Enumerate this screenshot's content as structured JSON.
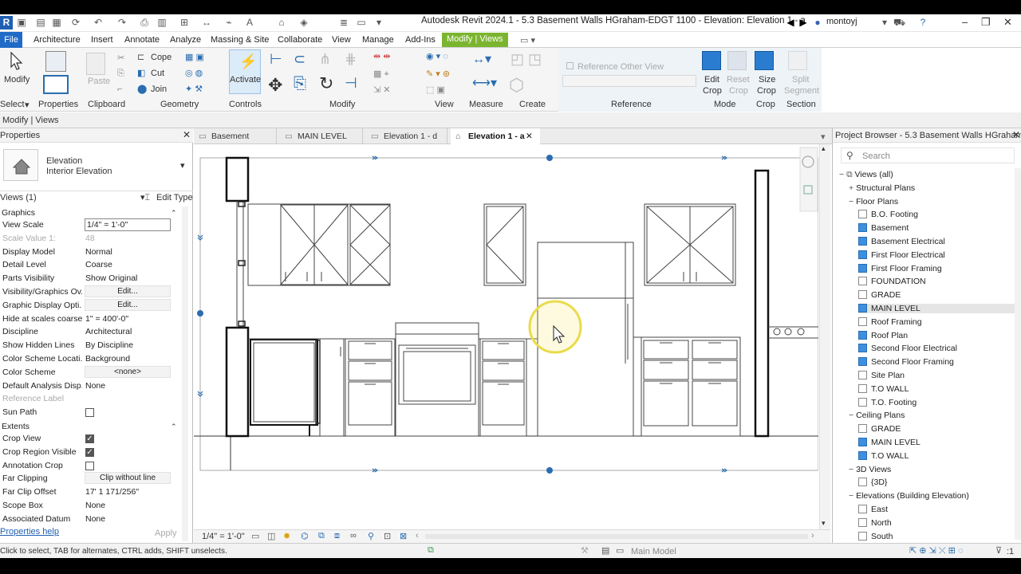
{
  "app": {
    "title": "Autodesk Revit 2024.1 - 5.3 Basement Walls HGraham-EDGT 1100 - Elevation: Elevation 1 - a",
    "logo": "R",
    "user": "montoyj"
  },
  "tabs": [
    "File",
    "Architecture",
    "Insert",
    "Annotate",
    "Analyze",
    "Massing & Site",
    "Collaborate",
    "View",
    "Manage",
    "Add-Ins",
    "Modify | Views"
  ],
  "ribbon": {
    "modify": "Modify",
    "select": "Select",
    "properties": "Properties",
    "clipboard": "Clipboard",
    "paste": "Paste",
    "cope": "Cope",
    "cut": "Cut",
    "join": "Join",
    "geometry": "Geometry",
    "activate": "Activate",
    "controls": "Controls",
    "modify_panel": "Modify",
    "view": "View",
    "measure": "Measure",
    "create": "Create",
    "ref_other_view": "Reference Other View",
    "reference": "Reference",
    "edit_crop_1": "Edit",
    "edit_crop_2": "Crop",
    "reset_crop_1": "Reset",
    "reset_crop_2": "Crop",
    "size_crop_1": "Size",
    "size_crop_2": "Crop",
    "split_seg_1": "Split",
    "split_seg_2": "Segment",
    "mode": "Mode",
    "crop": "Crop",
    "section": "Section"
  },
  "option_bar": "Modify | Views",
  "properties": {
    "header": "Properties",
    "type_1": "Elevation",
    "type_2": "Interior Elevation",
    "selector": "Views (1)",
    "edit_type": "Edit Type",
    "sections": {
      "graphics": "Graphics",
      "extents": "Extents"
    },
    "rows": [
      {
        "k": "View Scale",
        "v": "1/4\" = 1'-0\"",
        "kind": "input"
      },
      {
        "k": "Scale Value    1:",
        "v": "48",
        "kind": "dim"
      },
      {
        "k": "Display Model",
        "v": "Normal",
        "kind": "text"
      },
      {
        "k": "Detail Level",
        "v": "Coarse",
        "kind": "text"
      },
      {
        "k": "Parts Visibility",
        "v": "Show Original",
        "kind": "text"
      },
      {
        "k": "Visibility/Graphics Ov...",
        "v": "Edit...",
        "kind": "btn"
      },
      {
        "k": "Graphic Display Opti...",
        "v": "Edit...",
        "kind": "btn"
      },
      {
        "k": "Hide at scales coarse...",
        "v": "1\" = 400'-0\"",
        "kind": "text"
      },
      {
        "k": "Discipline",
        "v": "Architectural",
        "kind": "text"
      },
      {
        "k": "Show Hidden Lines",
        "v": "By Discipline",
        "kind": "text"
      },
      {
        "k": "Color Scheme Locati...",
        "v": "Background",
        "kind": "text"
      },
      {
        "k": "Color Scheme",
        "v": "<none>",
        "kind": "btn"
      },
      {
        "k": "Default Analysis Disp...",
        "v": "None",
        "kind": "text"
      },
      {
        "k": "Reference Label",
        "v": "",
        "kind": "dim"
      },
      {
        "k": "Sun Path",
        "v": "",
        "kind": "chk0"
      }
    ],
    "rows2": [
      {
        "k": "Crop View",
        "v": "",
        "kind": "chk1"
      },
      {
        "k": "Crop Region Visible",
        "v": "",
        "kind": "chk1"
      },
      {
        "k": "Annotation Crop",
        "v": "",
        "kind": "chk0"
      },
      {
        "k": "Far Clipping",
        "v": "Clip without line",
        "kind": "btn"
      },
      {
        "k": "Far Clip Offset",
        "v": "17'  1 171/256\"",
        "kind": "text"
      },
      {
        "k": "Scope Box",
        "v": "None",
        "kind": "text"
      },
      {
        "k": "Associated Datum",
        "v": "None",
        "kind": "text"
      }
    ],
    "help": "Properties help",
    "apply": "Apply"
  },
  "view_tabs": [
    "Basement",
    "MAIN LEVEL",
    "Elevation 1 - d",
    "Elevation 1 - a"
  ],
  "view_scale": "1/4\" = 1'-0\"",
  "browser": {
    "header": "Project Browser - 5.3 Basement Walls HGraham-...",
    "search": "Search",
    "items": [
      {
        "t": "Views (all)",
        "lvl": 0,
        "kind": "root"
      },
      {
        "t": "Structural Plans",
        "lvl": 1,
        "kind": "plus"
      },
      {
        "t": "Floor Plans",
        "lvl": 1,
        "kind": "minus"
      },
      {
        "t": "B.O. Footing",
        "lvl": 2,
        "kind": "box"
      },
      {
        "t": "Basement",
        "lvl": 2,
        "kind": "blue"
      },
      {
        "t": "Basement Electrical",
        "lvl": 2,
        "kind": "blue"
      },
      {
        "t": "First Floor Electrical",
        "lvl": 2,
        "kind": "blue"
      },
      {
        "t": "First Floor Framing",
        "lvl": 2,
        "kind": "blue"
      },
      {
        "t": "FOUNDATION",
        "lvl": 2,
        "kind": "box"
      },
      {
        "t": "GRADE",
        "lvl": 2,
        "kind": "box"
      },
      {
        "t": "MAIN LEVEL",
        "lvl": 2,
        "kind": "blue",
        "sel": true
      },
      {
        "t": "Roof Framing",
        "lvl": 2,
        "kind": "box"
      },
      {
        "t": "Roof Plan",
        "lvl": 2,
        "kind": "blue"
      },
      {
        "t": "Second Floor Electrical",
        "lvl": 2,
        "kind": "blue"
      },
      {
        "t": "Second Floor Framing",
        "lvl": 2,
        "kind": "blue"
      },
      {
        "t": "Site Plan",
        "lvl": 2,
        "kind": "box"
      },
      {
        "t": "T.O WALL",
        "lvl": 2,
        "kind": "box"
      },
      {
        "t": "T.O. Footing",
        "lvl": 2,
        "kind": "box"
      },
      {
        "t": "Ceiling Plans",
        "lvl": 1,
        "kind": "minus"
      },
      {
        "t": "GRADE",
        "lvl": 2,
        "kind": "box"
      },
      {
        "t": "MAIN LEVEL",
        "lvl": 2,
        "kind": "blue"
      },
      {
        "t": "T.O WALL",
        "lvl": 2,
        "kind": "blue"
      },
      {
        "t": "3D Views",
        "lvl": 1,
        "kind": "minus"
      },
      {
        "t": "{3D}",
        "lvl": 2,
        "kind": "box"
      },
      {
        "t": "Elevations (Building Elevation)",
        "lvl": 1,
        "kind": "minus"
      },
      {
        "t": "East",
        "lvl": 2,
        "kind": "box"
      },
      {
        "t": "North",
        "lvl": 2,
        "kind": "box"
      },
      {
        "t": "South",
        "lvl": 2,
        "kind": "box"
      }
    ]
  },
  "status": {
    "hint": "Click to select, TAB for alternates, CTRL adds, SHIFT unselects.",
    "model": "Main Model",
    "count": ":1"
  },
  "colors": {
    "accent": "#1f6bc7",
    "modify_tab": "#7bb530",
    "highlight": "#f2e24c"
  }
}
